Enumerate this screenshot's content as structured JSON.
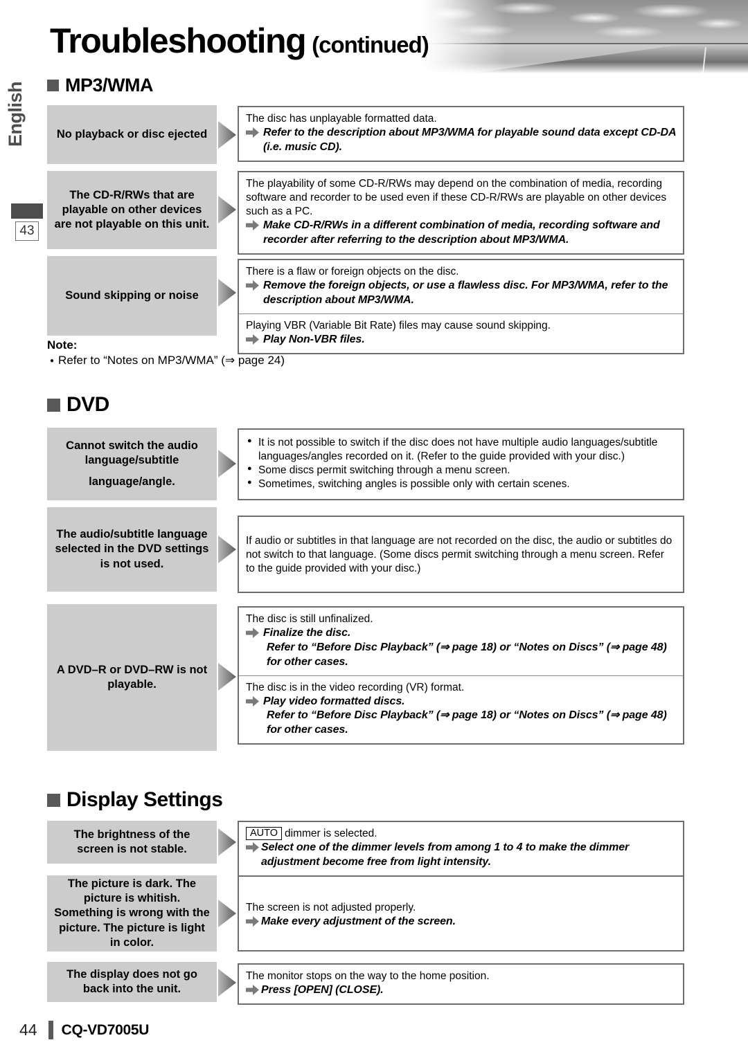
{
  "page": {
    "title_main": "Troubleshooting",
    "title_sub": "(continued)",
    "side_language": "English",
    "side_page_ref": "43",
    "footer_page": "44",
    "footer_model": "CQ-VD7005U",
    "banner_icon": "highway-photo"
  },
  "sections": [
    {
      "id": "mp3wma",
      "heading": "MP3/WMA",
      "rows": [
        {
          "symptom": "No playback or disc ejected",
          "cells": [
            {
              "cause": "The disc has unplayable formatted data.",
              "actions": [
                "Refer to the description about MP3/WMA for playable sound data except CD-DA (i.e. music CD)."
              ]
            }
          ]
        },
        {
          "symptom": "The CD-R/RWs that are playable on other devices are not playable on this unit.",
          "cells": [
            {
              "cause": "The playability of some CD-R/RWs may depend on the combination of media, recording software and recorder to be used even if these CD-R/RWs are playable on other devices such as a PC.",
              "actions": [
                "Make CD-R/RWs in a different combination of media, recording software and recorder after referring to the description about MP3/WMA."
              ]
            }
          ]
        },
        {
          "symptom": "Sound skipping or noise",
          "cells": [
            {
              "cause": "There is a flaw or foreign objects on the disc.",
              "actions": [
                "Remove the foreign objects, or use a flawless disc. For MP3/WMA, refer to the description about MP3/WMA."
              ]
            },
            {
              "cause": "Playing VBR (Variable Bit Rate) files may cause sound skipping.",
              "actions": [
                "Play Non-VBR files."
              ]
            }
          ]
        }
      ],
      "note": {
        "label": "Note:",
        "items": [
          "Refer to “Notes on MP3/WMA” (⇒ page 24)"
        ]
      }
    },
    {
      "id": "dvd",
      "heading": "DVD",
      "rows": [
        {
          "symptom_lines": [
            "Cannot switch the audio language/subtitle",
            "language/angle."
          ],
          "cells": [
            {
              "bullets": [
                "It is not possible to switch if the disc does not have multiple audio languages/subtitle languages/angles recorded on it. (Refer to the guide provided with your disc.)",
                "Some discs permit switching through a menu screen.",
                "Sometimes, switching angles is possible only with certain scenes."
              ]
            }
          ]
        },
        {
          "symptom": "The audio/subtitle language selected in the DVD settings is not used.",
          "cells": [
            {
              "cause": "If audio or subtitles in that language are not recorded on the disc, the audio or subtitles do not switch to that language. (Some discs permit switching through a menu screen. Refer to the guide provided with your disc.)",
              "actions": []
            }
          ]
        },
        {
          "symptom": "A DVD–R or DVD–RW is not playable.",
          "cells": [
            {
              "cause": "The disc is still unfinalized.",
              "actions": [
                "Finalize the disc.",
                "Refer to “Before Disc Playback” (⇒ page 18) or “Notes on Discs” (⇒ page 48) for other cases."
              ]
            },
            {
              "cause": "The disc is in the video recording (VR) format.",
              "actions": [
                "Play video formatted discs.",
                "Refer to “Before Disc Playback” (⇒ page 18) or “Notes on Discs” (⇒ page 48) for other cases."
              ]
            }
          ]
        }
      ]
    },
    {
      "id": "display-settings",
      "heading": "Display Settings",
      "rows": [
        {
          "symptom": "The brightness of the screen is not stable.",
          "cells": [
            {
              "key": "AUTO",
              "cause": "dimmer is selected.",
              "actions": [
                "Select one of the dimmer levels from among 1 to 4 to make the dimmer adjustment become free from light intensity."
              ]
            }
          ]
        },
        {
          "symptom": "The picture is dark. The picture is whitish. Something is wrong with the picture. The picture is light in color.",
          "cells": [
            {
              "cause": "The screen is not adjusted properly.",
              "actions": [
                "Make every adjustment of the screen."
              ]
            }
          ]
        },
        {
          "symptom": "The display does not go back into the unit.",
          "cells": [
            {
              "cause": "The monitor stops on the way to the home position.",
              "actions": [
                "Press [OPEN] (CLOSE)."
              ]
            }
          ]
        }
      ]
    }
  ]
}
